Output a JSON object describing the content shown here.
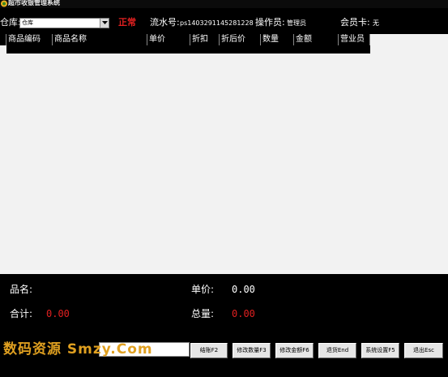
{
  "window": {
    "title": "超市收银管理系统"
  },
  "info": {
    "warehouse_label": "仓库:",
    "warehouse_value": "仓库",
    "status": "正常",
    "serial_label": "流水号:",
    "serial_value": "ps1403291145281228",
    "operator_label": "操作员:",
    "operator_value": "管理员",
    "member_label": "会员卡:",
    "member_value": "无"
  },
  "grid": {
    "columns": [
      "商品编码",
      "商品名称",
      "单价",
      "折扣",
      "折后价",
      "数量",
      "金额",
      "营业员"
    ]
  },
  "summary": {
    "product_name_label": "品名:",
    "product_name_value": "",
    "unit_price_label": "单价:",
    "unit_price_value": "0.00",
    "total_label": "合计:",
    "total_value": "0.00",
    "total_qty_label": "总量:",
    "total_qty_value": "0.00"
  },
  "bottom": {
    "watermark": "数码资源 Smzy.Com",
    "barcode_value": "",
    "buttons": [
      "结账F2",
      "修改数量F3",
      "修改金额F6",
      "退货End",
      "系统设置F5",
      "退出Esc"
    ]
  },
  "colors": {
    "status": "#e02020",
    "amount": "#e02020",
    "grid_bg": "#f2f2f2"
  }
}
